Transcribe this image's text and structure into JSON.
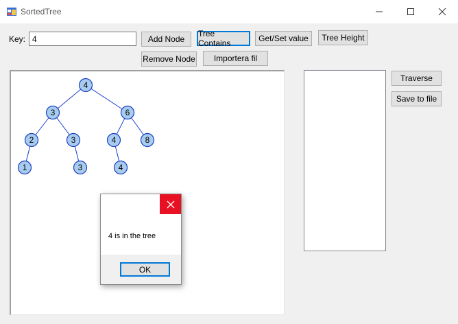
{
  "window": {
    "title": "SortedTree",
    "icon": "app-window-icon"
  },
  "key_label": "Key:",
  "key_value": "4",
  "buttons": {
    "add_node": "Add Node",
    "tree_contains": "Tree Contains",
    "get_set_value": "Get/Set value",
    "tree_height": "Tree Height",
    "remove_node": "Remove Node",
    "importera_fil": "Importera fil",
    "traverse": "Traverse",
    "save_to_file": "Save to file"
  },
  "tree": {
    "nodes": [
      {
        "id": "n4root",
        "value": "4"
      },
      {
        "id": "n3",
        "value": "3"
      },
      {
        "id": "n6",
        "value": "6"
      },
      {
        "id": "n2",
        "value": "2"
      },
      {
        "id": "n3b",
        "value": "3"
      },
      {
        "id": "n4b",
        "value": "4"
      },
      {
        "id": "n8",
        "value": "8"
      },
      {
        "id": "n1",
        "value": "1"
      },
      {
        "id": "n3c",
        "value": "3"
      },
      {
        "id": "n4c",
        "value": "4"
      }
    ],
    "edges": [
      [
        "n4root",
        "n3"
      ],
      [
        "n4root",
        "n6"
      ],
      [
        "n3",
        "n2"
      ],
      [
        "n3",
        "n3b"
      ],
      [
        "n6",
        "n4b"
      ],
      [
        "n6",
        "n8"
      ],
      [
        "n2",
        "n1"
      ],
      [
        "n3b",
        "n3c"
      ],
      [
        "n4b",
        "n4c"
      ]
    ],
    "node_fill": "#a8ccf0",
    "node_stroke": "#1a3fbf",
    "edge_color": "#1a3fd0"
  },
  "dialog": {
    "message": "4 is in the tree",
    "ok": "OK"
  }
}
